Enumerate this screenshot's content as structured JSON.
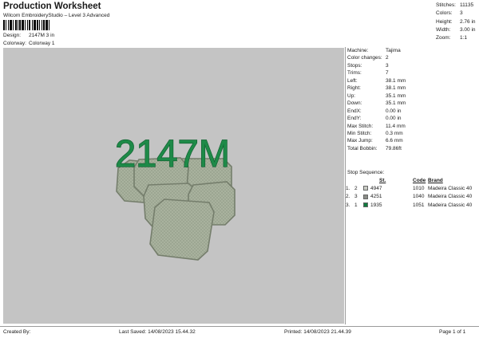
{
  "header": {
    "title": "Production Worksheet",
    "subtitle": "Wilcom EmbroideryStudio – Level 3 Advanced"
  },
  "design": {
    "label": "Design:",
    "value": "2147M 3 in"
  },
  "colorway": {
    "label": "Colorway:",
    "value": "Colorway 1"
  },
  "stats": [
    {
      "label": "Stitches:",
      "value": "11135"
    },
    {
      "label": "Colors:",
      "value": "3"
    },
    {
      "label": "Height:",
      "value": "2.76 in"
    },
    {
      "label": "Width:",
      "value": "3.00 in"
    },
    {
      "label": "Zoom:",
      "value": "1:1"
    }
  ],
  "specs": [
    {
      "label": "Machine:",
      "value": "Tajima"
    },
    {
      "label": "Color changes:",
      "value": "2"
    },
    {
      "label": "Stops:",
      "value": "3"
    },
    {
      "label": "Trims:",
      "value": "7"
    },
    {
      "label": "Left:",
      "value": "38.1 mm"
    },
    {
      "label": "Right:",
      "value": "38.1 mm"
    },
    {
      "label": "Up:",
      "value": "35.1 mm"
    },
    {
      "label": "Down:",
      "value": "35.1 mm"
    },
    {
      "label": "EndX:",
      "value": "0.00 in"
    },
    {
      "label": "EndY:",
      "value": "0.00 in"
    },
    {
      "label": "Max Stitch:",
      "value": "11.4 mm"
    },
    {
      "label": "Min Stitch:",
      "value": "0.3 mm"
    },
    {
      "label": "Max Jump:",
      "value": "6.6 mm"
    },
    {
      "label": "Total Bobbin:",
      "value": "79.86ft"
    }
  ],
  "stop_sequence": {
    "title": "Stop Sequence:",
    "headers": {
      "st": "St.",
      "code": "Code",
      "brand": "Brand"
    },
    "rows": [
      {
        "stop": "1.",
        "color_no": "2",
        "st": "4947",
        "code": "1010",
        "brand": "Madeira Classic 40",
        "swatch": "#c9cbc4"
      },
      {
        "stop": "2.",
        "color_no": "3",
        "st": "4251",
        "code": "1040",
        "brand": "Madeira Classic 40",
        "swatch": "#8b8d88"
      },
      {
        "stop": "3.",
        "color_no": "1",
        "st": "1935",
        "code": "1051",
        "brand": "Madeira Classic 40",
        "swatch": "#0f7a3d"
      }
    ]
  },
  "design_preview": {
    "text": "2147M",
    "text_color": "#1e8a48",
    "tile_color": "#a9b29e"
  },
  "footer": {
    "created_by": "Created By:",
    "last_saved": "Last Saved: 14/08/2023 15.44.32",
    "printed": "Printed: 14/08/2023 21.44.39",
    "page": "Page 1 of 1"
  }
}
